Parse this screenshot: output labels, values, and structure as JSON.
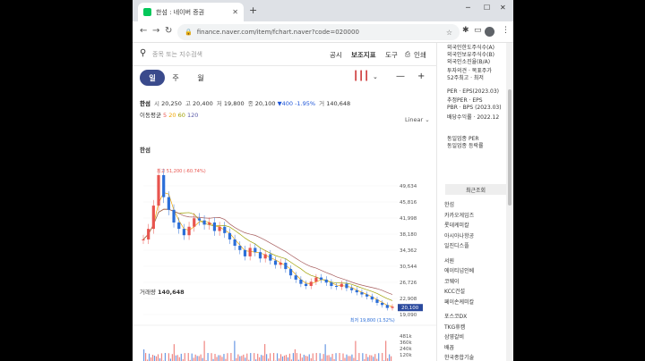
{
  "browser": {
    "tab_title": "한섬 : 네이버 증권",
    "url": "finance.naver.com/item/fchart.naver?code=020000",
    "new_tab": "+",
    "tab_close": "✕"
  },
  "search": {
    "placeholder": "종목 또는 지수검색",
    "links": [
      "공시",
      "보조지표",
      "도구",
      "인쇄"
    ]
  },
  "periods": [
    "일",
    "주",
    "월"
  ],
  "active_period": "일",
  "price": {
    "name": "한섬",
    "open_label": "시",
    "open": "20,250",
    "high_label": "고",
    "high": "20,400",
    "low_label": "저",
    "low": "19,800",
    "close_label": "종",
    "close": "20,100",
    "change": "▼400 -1.95%",
    "volume_label": "거",
    "volume": "140,648"
  },
  "ma": {
    "label": "이동평균",
    "m5": "5",
    "m20": "20",
    "m60": "60",
    "m120": "120"
  },
  "scale": "Linear",
  "chart_data": {
    "type": "line",
    "title": "한섬",
    "y_ticks": [
      "49,634",
      "45,816",
      "41,998",
      "38,180",
      "34,362",
      "30,544",
      "26,726",
      "22,908",
      "19,090"
    ],
    "x_ticks": [
      "6월",
      "10월",
      "2022",
      "4월",
      "8월",
      "2023",
      "4월"
    ],
    "max_label": "최고 51,200 (-60.74%)",
    "min_label": "최저 19,800 (1.52%)",
    "current_price_tag": "20,100",
    "ylim": [
      19090,
      51200
    ],
    "series": [
      {
        "values": [
          36000,
          38500,
          44000,
          51200,
          46000,
          43000,
          40000,
          38500,
          37000,
          39000,
          41000,
          40500,
          39500,
          40000,
          38000,
          39000,
          37500,
          36000,
          34500,
          33500,
          32000,
          34000,
          33000,
          31500,
          32500,
          31000,
          30000,
          30500,
          29000,
          27500,
          26500,
          25500,
          25000,
          26000,
          27000,
          26500,
          25800,
          25000,
          24800,
          25500,
          24500,
          24000,
          23500,
          23000,
          22500,
          21800,
          21000,
          20500,
          19800,
          20100
        ]
      }
    ]
  },
  "volume": {
    "title": "거래량",
    "value": "140,648",
    "ticks": [
      "481k",
      "360k",
      "240k",
      "120k"
    ]
  },
  "sidebar": {
    "rows": [
      "외국인한도주식수(A)",
      "외국인보유주식수(B)",
      "외국인소진율(B/A)",
      "투자의견 · 목표주가",
      "52주최고 · 최저",
      "PER · EPS(2023.03)",
      "추정PER · EPS",
      "PBR · BPS (2023.03)",
      "배당수익률 · 2022.12",
      "동일업종 PER",
      "동일업종 등락률"
    ],
    "recent_label": "최근조회",
    "recent_items": [
      "한섬",
      "카카오게임즈",
      "롯데케미칼",
      "아시아나항공",
      "일진디스플",
      "서원",
      "에이티넘인베",
      "코웨이",
      "KCC건설",
      "페이손케미칼",
      "포스코DX",
      "TKG휴켐",
      "삼영갈비",
      "배꼽",
      "한국종합기술"
    ]
  }
}
